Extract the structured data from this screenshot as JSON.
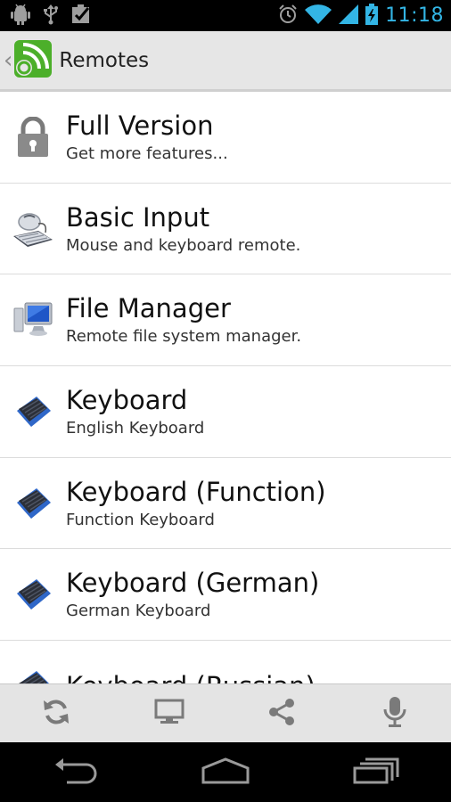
{
  "status_bar": {
    "time": "11:18",
    "left_icons": [
      "android-debug-icon",
      "usb-icon",
      "checkbox-icon"
    ],
    "right_icons": [
      "alarm-icon",
      "wifi-icon",
      "signal-icon",
      "battery-charging-icon"
    ]
  },
  "action_bar": {
    "title": "Remotes"
  },
  "remotes": [
    {
      "title": "Full Version",
      "subtitle": "Get more features...",
      "icon": "lock-icon"
    },
    {
      "title": "Basic Input",
      "subtitle": "Mouse and keyboard remote.",
      "icon": "mouse-keyboard-icon"
    },
    {
      "title": "File Manager",
      "subtitle": "Remote file system manager.",
      "icon": "computer-icon"
    },
    {
      "title": "Keyboard",
      "subtitle": "English Keyboard",
      "icon": "keyboard-icon"
    },
    {
      "title": "Keyboard (Function)",
      "subtitle": "Function Keyboard",
      "icon": "keyboard-icon"
    },
    {
      "title": "Keyboard (German)",
      "subtitle": "German Keyboard",
      "icon": "keyboard-icon"
    },
    {
      "title": "Keyboard (Russian)",
      "subtitle": "",
      "icon": "keyboard-icon"
    }
  ],
  "toolbar": {
    "buttons": [
      "refresh-icon",
      "monitor-icon",
      "share-icon",
      "microphone-icon"
    ]
  },
  "navigation": {
    "buttons": [
      "back-icon",
      "home-icon",
      "recent-apps-icon"
    ]
  },
  "colors": {
    "status_accent": "#33b5e5",
    "app_green": "#4caf2a"
  }
}
